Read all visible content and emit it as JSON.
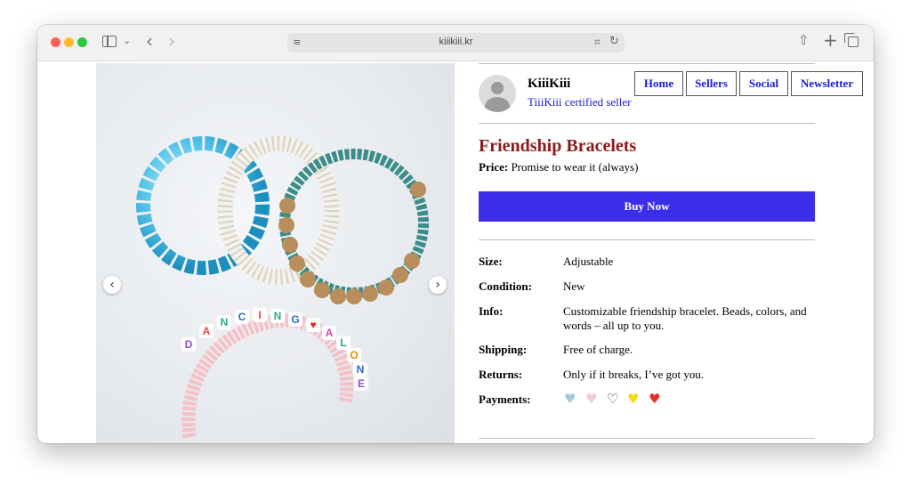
{
  "browser": {
    "url": "kiiikiii.kr"
  },
  "seller": {
    "name": "KiiiKiii",
    "subtitle": "TiiiKiii certified seller"
  },
  "nav": {
    "home": "Home",
    "sellers": "Sellers",
    "social": "Social",
    "newsletter": "Newsletter"
  },
  "product": {
    "title": "Friendship Bracelets",
    "price_label": "Price:",
    "price_value": "Promise to wear it (always)",
    "buy_label": "Buy Now",
    "image_word": "DANCING ALONE"
  },
  "specs": {
    "size_label": "Size:",
    "size_value": "Adjustable",
    "condition_label": "Condition:",
    "condition_value": "New",
    "info_label": "Info:",
    "info_value": "Customizable friendship bracelet. Beads, colors, and words – all up to you.",
    "shipping_label": "Shipping:",
    "shipping_value": "Free of charge.",
    "returns_label": "Returns:",
    "returns_value": "Only if it breaks, I’ve got you.",
    "payments_label": "Payments:"
  },
  "payment_icons": [
    {
      "icon": "heart-blue-icon",
      "color": "#a9c8dc"
    },
    {
      "icon": "heart-pink-icon",
      "color": "#f2c6de"
    },
    {
      "icon": "heart-outline-icon",
      "color": "#333333"
    },
    {
      "icon": "heart-yellow-icon",
      "color": "#f3d91a"
    },
    {
      "icon": "heart-red-icon",
      "color": "#e0302a"
    }
  ]
}
